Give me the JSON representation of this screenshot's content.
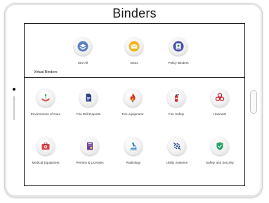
{
  "page": {
    "title": "Binders"
  },
  "virtual_binders": {
    "section_label": "Virtual Binders",
    "items": [
      {
        "label": "See All",
        "icon": "stack-layers-icon",
        "color": "#5b7fbf"
      },
      {
        "label": "Inbox",
        "icon": "envelope-icon",
        "color": "#f2b21a"
      },
      {
        "label": "Policy Binders",
        "icon": "policy-binder-icon",
        "color": "#4a4fa8"
      }
    ]
  },
  "categories": {
    "items": [
      {
        "label": "Environment of Care",
        "icon": "hands-plant-icon",
        "color": "#e8584b"
      },
      {
        "label": "Fire Drill Reports",
        "icon": "document-icon",
        "color": "#2b3e8a"
      },
      {
        "label": "Fire equipment",
        "icon": "flame-icon",
        "color": "#d23a1e"
      },
      {
        "label": "Fire Safety",
        "icon": "fire-extinguisher-icon",
        "color": "#d8262a"
      },
      {
        "label": "Hazmats",
        "icon": "biohazard-icon",
        "color": "#c81e2b"
      },
      {
        "label": "Medical Equipment",
        "icon": "medical-kit-icon",
        "color": "#d8454a"
      },
      {
        "label": "Permits & Licenses",
        "icon": "certificate-icon",
        "color": "#6a3fa0"
      },
      {
        "label": "Radiology",
        "icon": "microscope-icon",
        "color": "#1f7fc2"
      },
      {
        "label": "Utility Systems",
        "icon": "gear-wrench-icon",
        "color": "#2a4a8c"
      },
      {
        "label": "Safety and Security",
        "icon": "shield-check-icon",
        "color": "#2aa468"
      }
    ]
  }
}
